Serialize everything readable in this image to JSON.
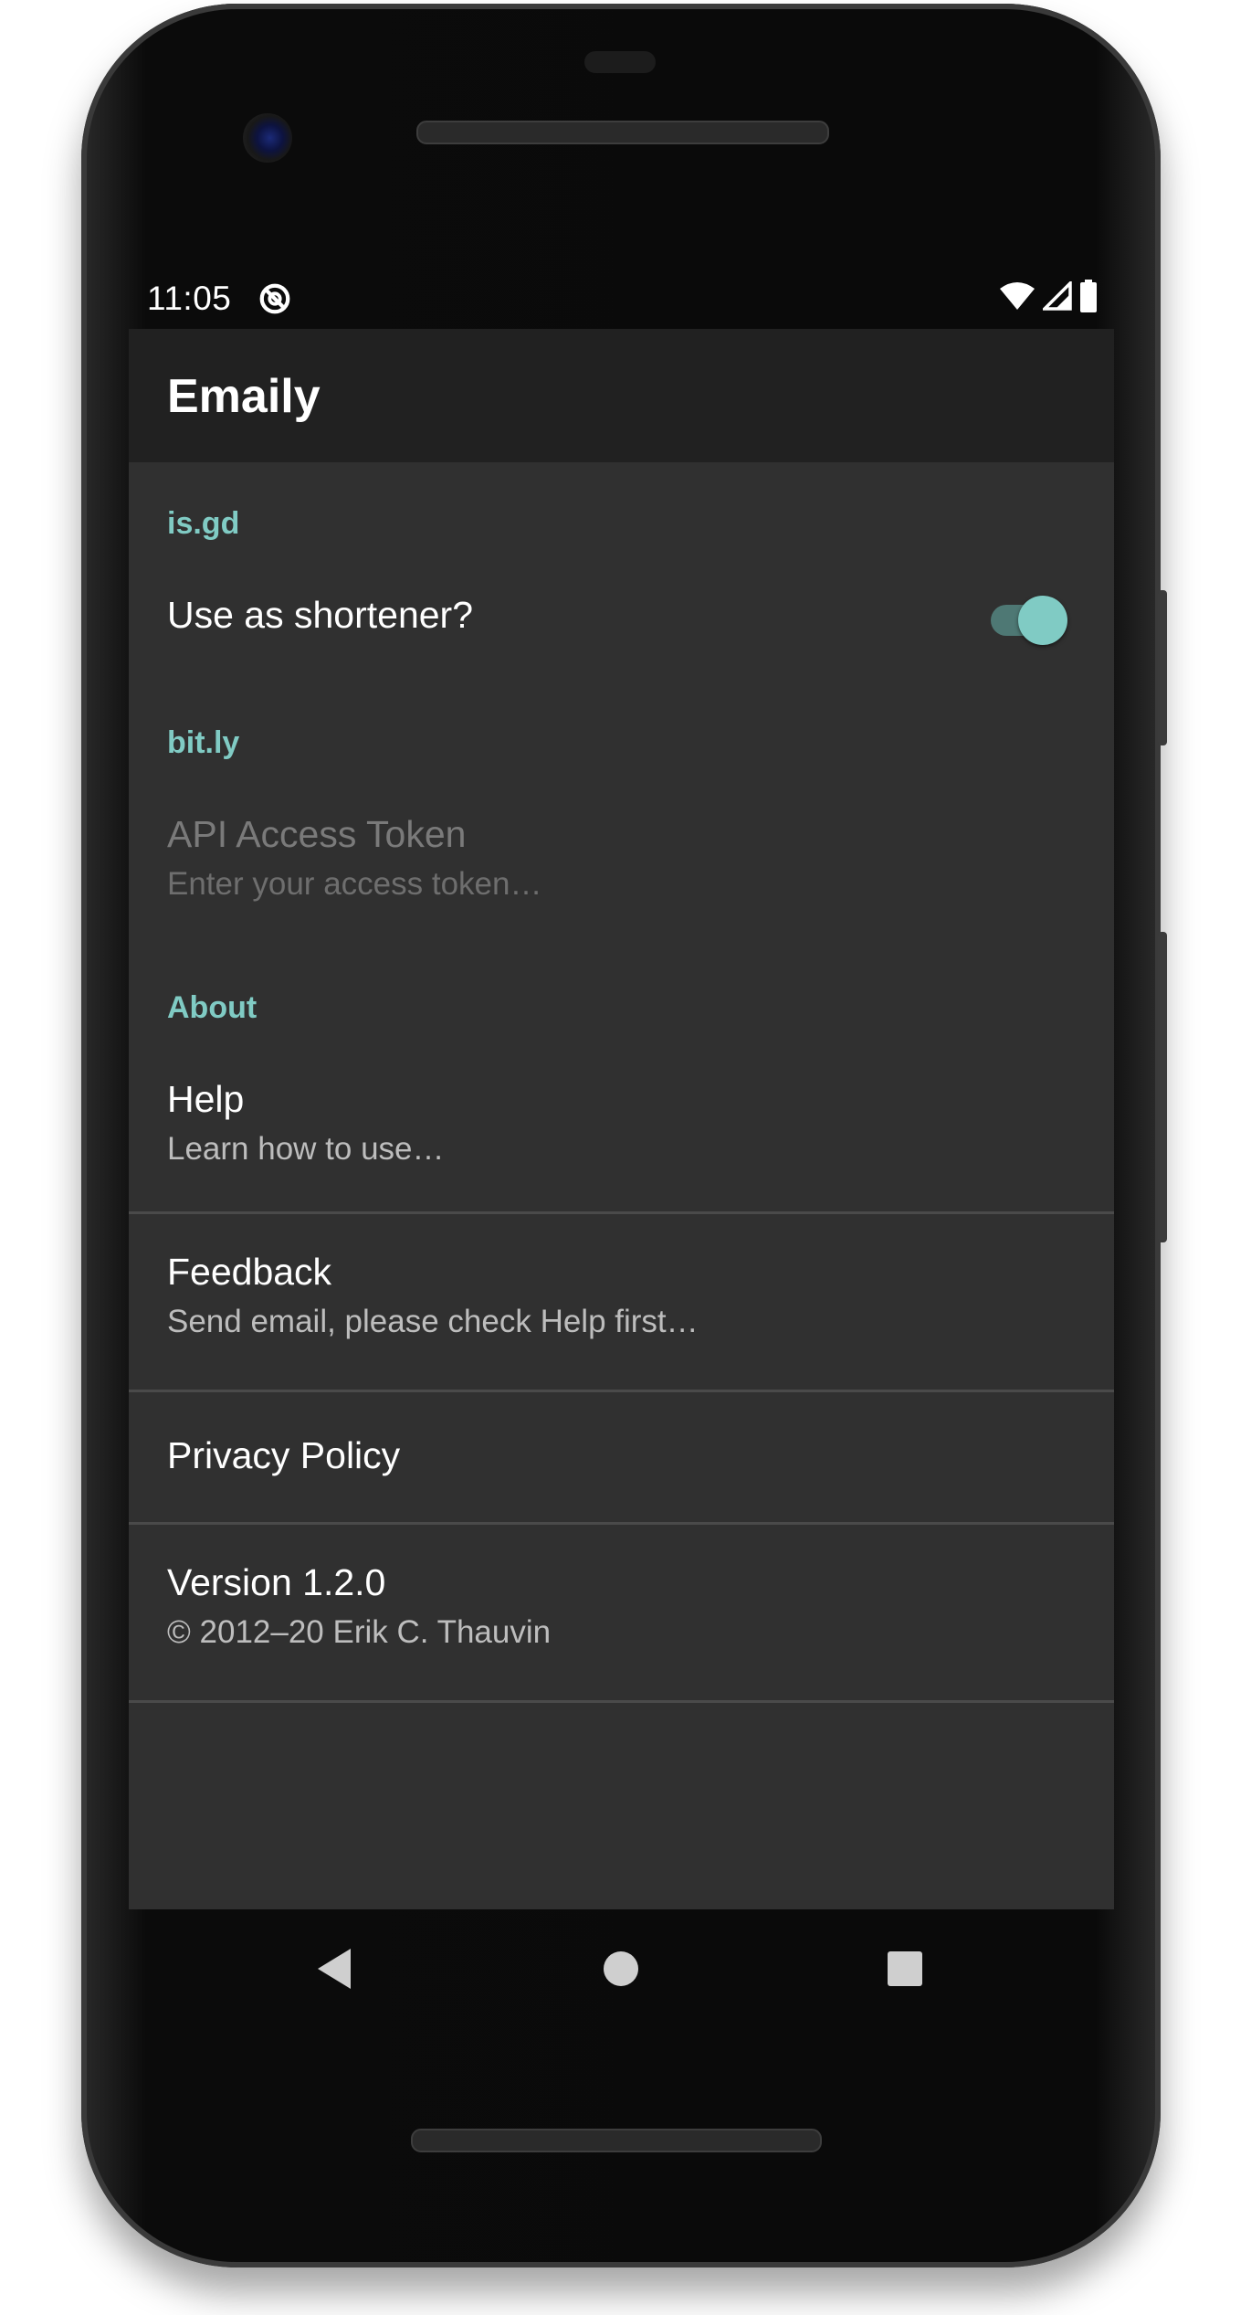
{
  "status_bar": {
    "time": "11:05",
    "icons": [
      "vpn-key-icon",
      "wifi-icon",
      "signal-icon",
      "battery-icon"
    ]
  },
  "app_bar": {
    "title": "Emaily"
  },
  "sections": {
    "isgd": {
      "header": "is.gd",
      "use_shortener": {
        "title": "Use as shortener?",
        "enabled": true
      }
    },
    "bitly": {
      "header": "bit.ly",
      "api_token": {
        "title": "API Access Token",
        "summary": "Enter your access token…"
      }
    },
    "about": {
      "header": "About",
      "help": {
        "title": "Help",
        "summary": "Learn how to use…"
      },
      "feedback": {
        "title": "Feedback",
        "summary": "Send email, please check Help first…"
      },
      "privacy": {
        "title": "Privacy Policy"
      },
      "version": {
        "title": "Version 1.2.0",
        "summary": "© 2012–20 Erik C. Thauvin"
      }
    }
  },
  "nav_bar": {
    "icons": [
      "back-icon",
      "home-icon",
      "recents-icon"
    ]
  },
  "colors": {
    "accent": "#80cbc4",
    "app_bar_bg": "#212121",
    "content_bg": "#303030",
    "text_primary": "#ffffff",
    "text_secondary": "#bdbdbd"
  }
}
